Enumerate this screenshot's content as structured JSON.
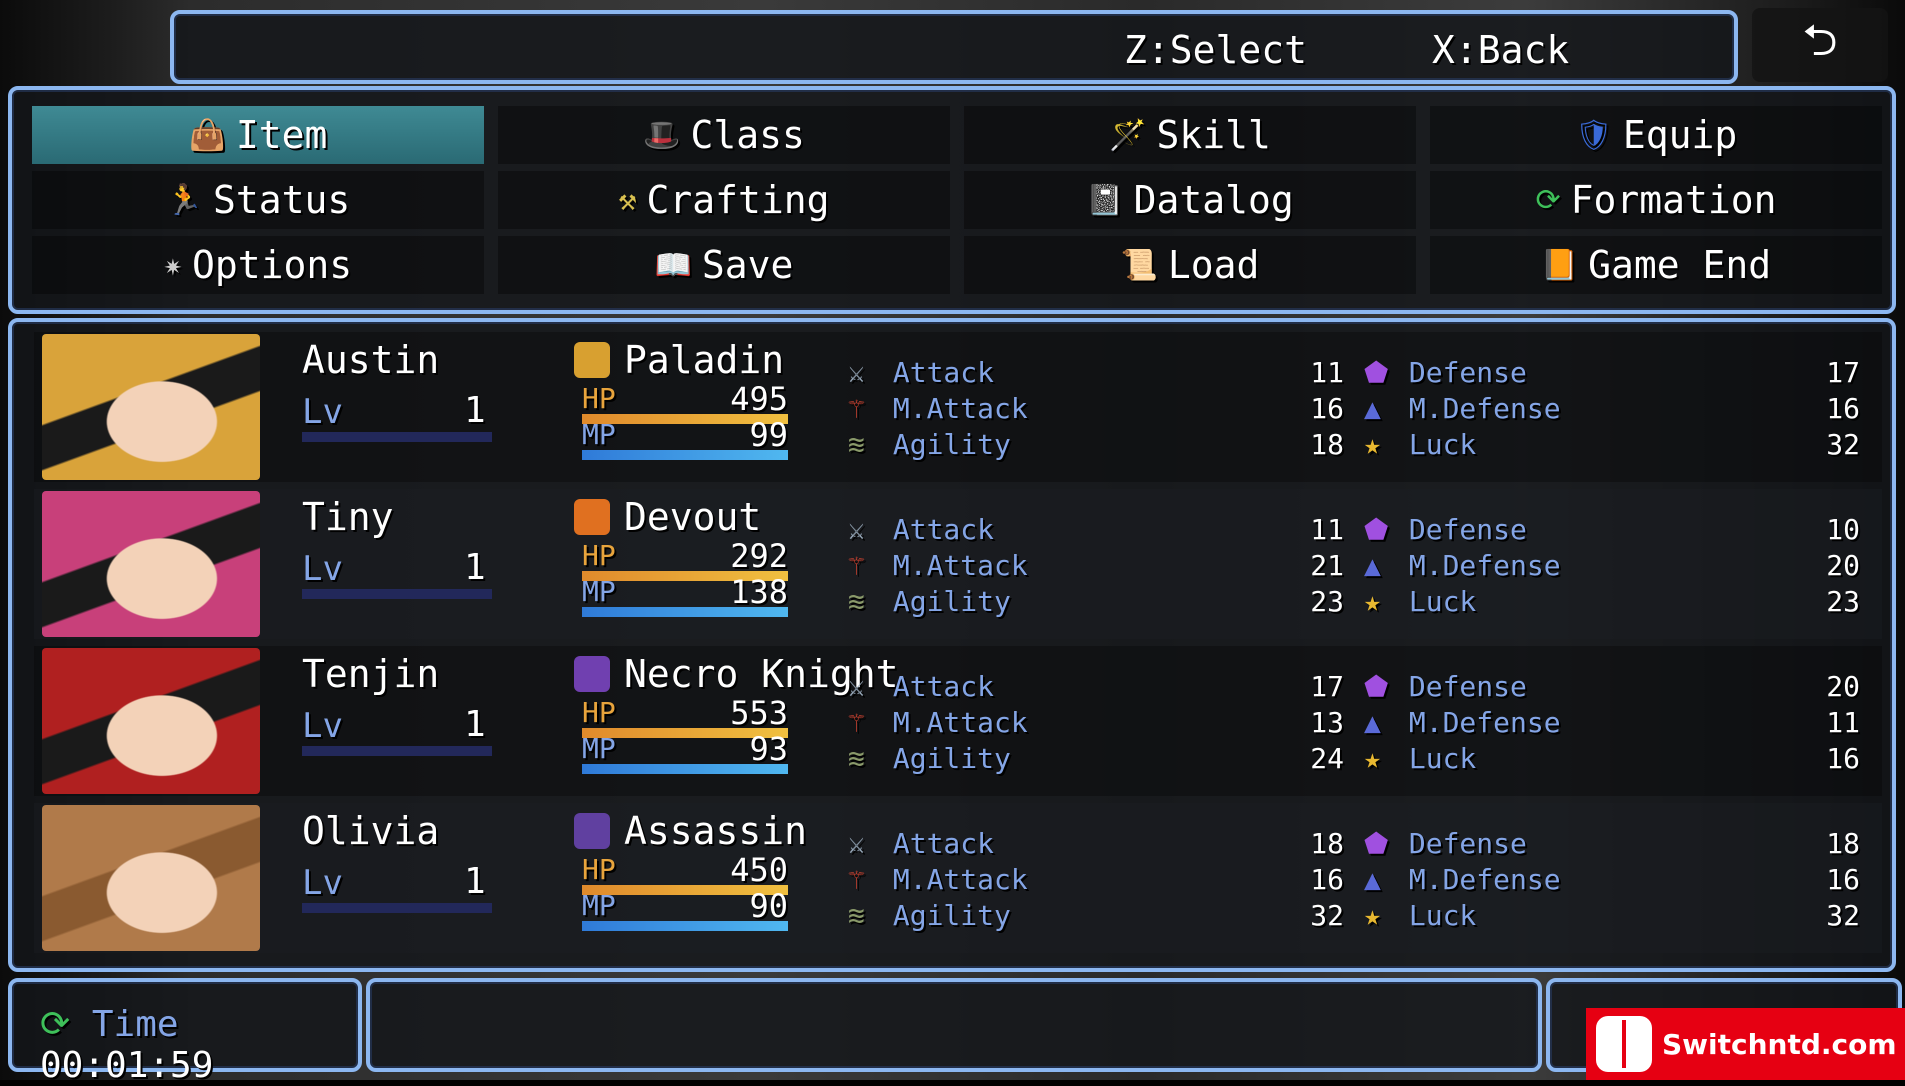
{
  "help": {
    "select": "Z:Select",
    "back": "X:Back"
  },
  "back_button_icon": "undo-arrow-icon",
  "menu": [
    {
      "label": "Item",
      "icon": "bag-icon",
      "selected": true
    },
    {
      "label": "Class",
      "icon": "wizard-hat-icon"
    },
    {
      "label": "Skill",
      "icon": "wand-icon"
    },
    {
      "label": "Equip",
      "icon": "armor-icon"
    },
    {
      "label": "Status",
      "icon": "figure-icon"
    },
    {
      "label": "Crafting",
      "icon": "tools-icon"
    },
    {
      "label": "Datalog",
      "icon": "book-icon"
    },
    {
      "label": "Formation",
      "icon": "cycle-icon"
    },
    {
      "label": "Options",
      "icon": "gear-icon"
    },
    {
      "label": "Save",
      "icon": "open-book-icon"
    },
    {
      "label": "Load",
      "icon": "scroll-icon"
    },
    {
      "label": "Game End",
      "icon": "closed-book-icon"
    }
  ],
  "party": [
    {
      "name": "Austin",
      "lv_label": "Lv",
      "level": "1",
      "class": "Paladin",
      "class_color": "#d8a030",
      "hp": "495",
      "mp": "99",
      "face_color": "#d9a33a",
      "hair": "#1a1a1a",
      "attack": "11",
      "mattack": "16",
      "agility": "18",
      "defense": "17",
      "mdefense": "16",
      "luck": "32"
    },
    {
      "name": "Tiny",
      "lv_label": "Lv",
      "level": "1",
      "class": "Devout",
      "class_color": "#e07020",
      "hp": "292",
      "mp": "138",
      "face_color": "#c8407a",
      "hair": "#1a1a1a",
      "attack": "11",
      "mattack": "21",
      "agility": "23",
      "defense": "10",
      "mdefense": "20",
      "luck": "23"
    },
    {
      "name": "Tenjin",
      "lv_label": "Lv",
      "level": "1",
      "class": "Necro Knight",
      "class_color": "#7040b0",
      "hp": "553",
      "mp": "93",
      "face_color": "#b02020",
      "hair": "#1a1a1a",
      "attack": "17",
      "mattack": "13",
      "agility": "24",
      "defense": "20",
      "mdefense": "11",
      "luck": "16"
    },
    {
      "name": "Olivia",
      "lv_label": "Lv",
      "level": "1",
      "class": "Assassin",
      "class_color": "#6040a0",
      "hp": "450",
      "mp": "90",
      "face_color": "#b07a4a",
      "hair": "#8a5a30",
      "attack": "18",
      "mattack": "16",
      "agility": "32",
      "defense": "18",
      "mdefense": "16",
      "luck": "32"
    }
  ],
  "param_labels": {
    "attack": "Attack",
    "mattack": "M.Attack",
    "agility": "Agility",
    "defense": "Defense",
    "mdefense": "M.Defense",
    "luck": "Luck"
  },
  "gauge_labels": {
    "hp": "HP",
    "mp": "MP"
  },
  "time": {
    "label": "Time",
    "value": "00:01:59"
  },
  "watermark": "Switchntd.com"
}
